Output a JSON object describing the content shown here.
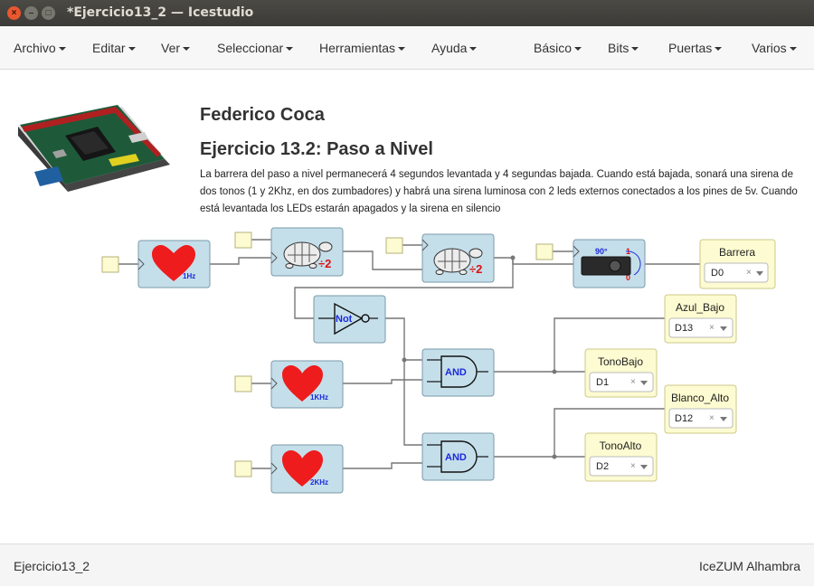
{
  "window": {
    "title": "*Ejercicio13_2 — Icestudio"
  },
  "menu": {
    "left": [
      "Archivo",
      "Editar",
      "Ver",
      "Seleccionar",
      "Herramientas",
      "Ayuda"
    ],
    "right": [
      "Básico",
      "Bits",
      "Puertas",
      "Varios"
    ]
  },
  "header": {
    "author": "Federico Coca",
    "exercise": "Ejercicio 13.2: Paso a Nivel",
    "description": "La barrera del paso a nivel permanecerá 4 segundos levantada y 4 segundas bajada. Cuando está bajada, sonará una sirena de dos tonos (1 y 2Khz, en dos zumbadores) y habrá una sirena luminosa con 2 leds externos conectados a los pines de 5v. Cuando está levantada los LEDs estarán apagados y la sirena en silencio"
  },
  "blocks": {
    "clk1": "1Hz",
    "clk2": "1KHz",
    "clk3": "2KHz",
    "div1": "÷2",
    "div2": "÷2",
    "not": "Not",
    "and1": "AND",
    "and2": "AND",
    "servo_top": "90°",
    "servo_bottom": "0",
    "servo_one": "1"
  },
  "outputs": [
    {
      "name": "Barrera",
      "pin": "D0"
    },
    {
      "name": "Azul_Bajo",
      "pin": "D13"
    },
    {
      "name": "TonoBajo",
      "pin": "D1"
    },
    {
      "name": "Blanco_Alto",
      "pin": "D12"
    },
    {
      "name": "TonoAlto",
      "pin": "D2"
    }
  ],
  "footer": {
    "left": "Ejercicio13_2",
    "right": "IceZUM Alhambra"
  },
  "colors": {
    "block_fill": "#c5dfea",
    "block_stroke": "#7a9aa8",
    "output_fill": "#fdfbd1",
    "output_stroke": "#cdc98a",
    "heart": "#ee1c1c",
    "wire": "#777777",
    "title_bar": "#3d3c38",
    "close_button": "#e9572f"
  }
}
